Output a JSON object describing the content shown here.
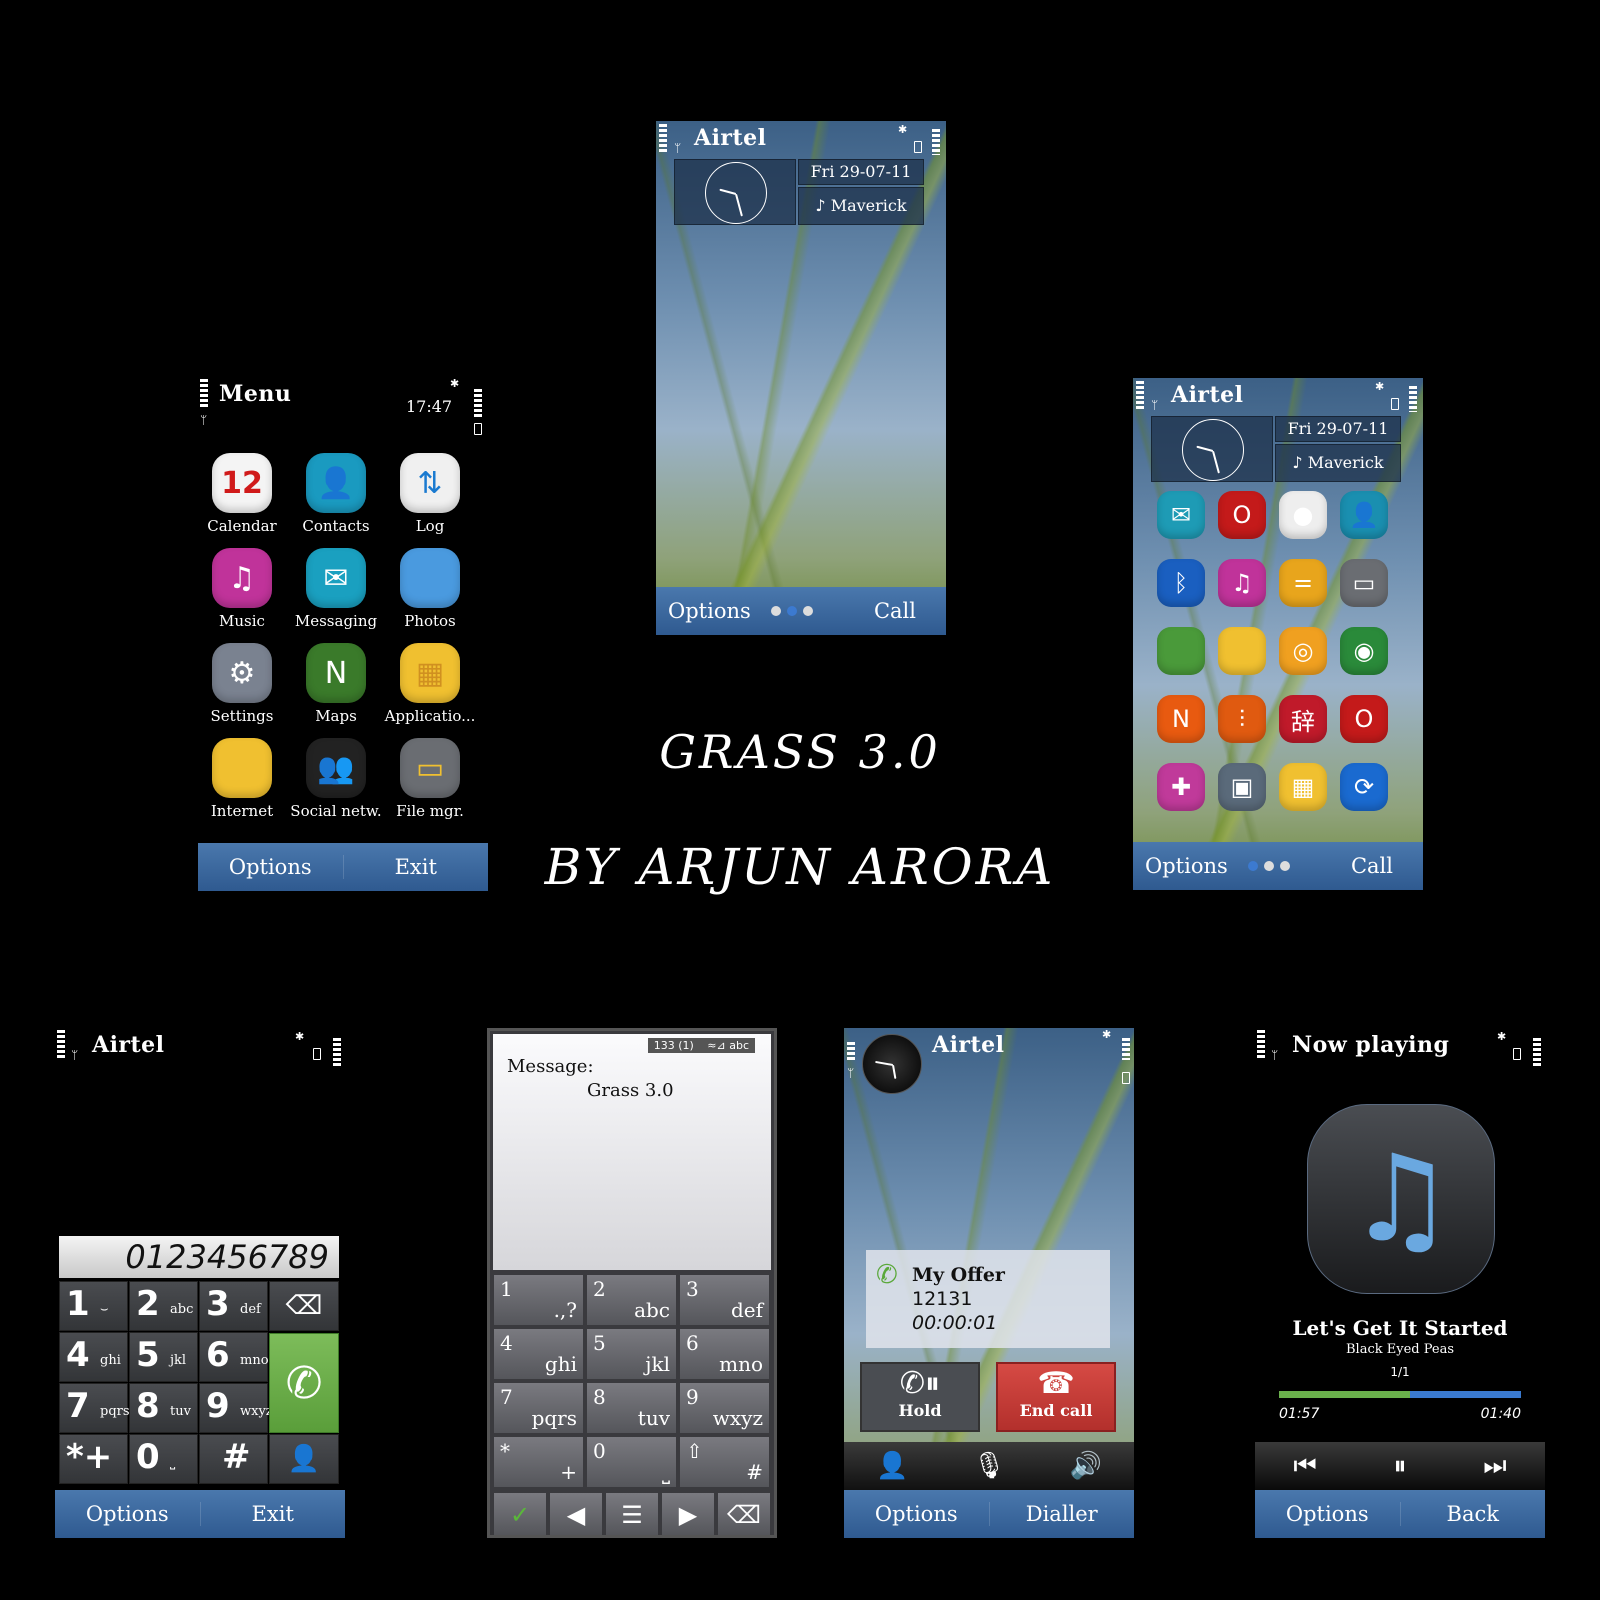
{
  "title": {
    "theme_name": "GRASS 3.0",
    "author_line": "BY ARJUN ARORA"
  },
  "colors": {
    "background": "#000000",
    "softkey_bar": "#3a67a0",
    "call_green": "#6aa84f",
    "end_call_red": "#c93a36",
    "progress_played": "#6ab04c",
    "progress_remaining": "#3a7ad0",
    "music_note": "#6aa8e0"
  },
  "home_screen": {
    "operator": "Airtel",
    "date": "Fri 29-07-11",
    "profile": "♪ Maverick",
    "softkeys": {
      "left": "Options",
      "right": "Call"
    },
    "page_dots": 3,
    "active_dot": 2
  },
  "menu_screen": {
    "title": "Menu",
    "time": "17:47",
    "items": [
      {
        "label": "Calendar",
        "icon": "calendar-icon",
        "glyph": "12"
      },
      {
        "label": "Contacts",
        "icon": "contacts-icon",
        "glyph": "👤"
      },
      {
        "label": "Log",
        "icon": "log-icon",
        "glyph": "⇅"
      },
      {
        "label": "Music",
        "icon": "music-icon",
        "glyph": "♫"
      },
      {
        "label": "Messaging",
        "icon": "messaging-icon",
        "glyph": "✉"
      },
      {
        "label": "Photos",
        "icon": "photos-icon",
        "glyph": ""
      },
      {
        "label": "Settings",
        "icon": "settings-icon",
        "glyph": "⚙"
      },
      {
        "label": "Maps",
        "icon": "maps-icon",
        "glyph": "N"
      },
      {
        "label": "Applicatio...",
        "icon": "applications-icon",
        "glyph": "▦"
      },
      {
        "label": "Internet",
        "icon": "internet-folder-icon",
        "glyph": ""
      },
      {
        "label": "Social netw.",
        "icon": "social-network-icon",
        "glyph": "👥"
      },
      {
        "label": "File mgr.",
        "icon": "file-manager-icon",
        "glyph": "▭"
      }
    ],
    "softkeys": {
      "left": "Options",
      "right": "Exit"
    }
  },
  "home_shortcuts_screen": {
    "operator": "Airtel",
    "date": "Fri 29-07-11",
    "profile": "♪ Maverick",
    "shortcuts": [
      {
        "icon": "messaging-icon",
        "glyph": "✉",
        "color": "#1e9bb5"
      },
      {
        "icon": "opera-icon",
        "glyph": "O",
        "color": "#c41a1a"
      },
      {
        "icon": "palette-icon",
        "glyph": "●",
        "color": "#eeeeee"
      },
      {
        "icon": "contacts-icon",
        "glyph": "👤",
        "color": "#1a8fb0"
      },
      {
        "icon": "bluetooth-icon",
        "glyph": "ᛒ",
        "color": "#1a5fc0"
      },
      {
        "icon": "music-player-icon",
        "glyph": "♫",
        "color": "#c0339a"
      },
      {
        "icon": "notes-icon",
        "glyph": "=",
        "color": "#e8a51c"
      },
      {
        "icon": "file-manager-icon",
        "glyph": "▭",
        "color": "#6a6d72"
      },
      {
        "icon": "photos-icon",
        "glyph": "",
        "color": "#4a9a3a"
      },
      {
        "icon": "folder-icon",
        "glyph": "",
        "color": "#f0c030"
      },
      {
        "icon": "uc-browser-icon",
        "glyph": "◎",
        "color": "#f0a020"
      },
      {
        "icon": "camera-icon",
        "glyph": "◉",
        "color": "#2a8a3a"
      },
      {
        "icon": "nimbuzz-icon",
        "glyph": "N",
        "color": "#e85a10"
      },
      {
        "icon": "rar-icon",
        "glyph": "⫶",
        "color": "#e05a10"
      },
      {
        "icon": "dictionary-icon",
        "glyph": "辞",
        "color": "#c01a2a"
      },
      {
        "icon": "opera-mini-icon",
        "glyph": "O",
        "color": "#c41a1a"
      },
      {
        "icon": "games-icon",
        "glyph": "✚",
        "color": "#c03a9a"
      },
      {
        "icon": "gallery-icon",
        "glyph": "▣",
        "color": "#5a6a7a"
      },
      {
        "icon": "applications-icon",
        "glyph": "▦",
        "color": "#f0c030"
      },
      {
        "icon": "sync-icon",
        "glyph": "⟳",
        "color": "#1a6ad0"
      }
    ],
    "softkeys": {
      "left": "Options",
      "right": "Call"
    },
    "page_dots": 3,
    "active_dot": 1
  },
  "dialer_screen": {
    "operator": "Airtel",
    "number": "0123456789",
    "keys": [
      {
        "digit": "1",
        "letters": "⌣"
      },
      {
        "digit": "2",
        "letters": "abc"
      },
      {
        "digit": "3",
        "letters": "def"
      },
      {
        "digit": "4",
        "letters": "ghi"
      },
      {
        "digit": "5",
        "letters": "jkl"
      },
      {
        "digit": "6",
        "letters": "mno"
      },
      {
        "digit": "7",
        "letters": "pqrs"
      },
      {
        "digit": "8",
        "letters": "tuv"
      },
      {
        "digit": "9",
        "letters": "wxyz"
      },
      {
        "digit": "*+",
        "letters": ""
      },
      {
        "digit": "0",
        "letters": "⎵"
      },
      {
        "digit": "#",
        "letters": ""
      }
    ],
    "softkeys": {
      "left": "Options",
      "right": "Exit"
    }
  },
  "message_screen": {
    "counter": "133 (1)",
    "input_mode": "≈⊿ abc",
    "label": "Message:",
    "body": "Grass 3.0",
    "keys": [
      {
        "digit": "1",
        "letters": ".,?"
      },
      {
        "digit": "2",
        "letters": "abc"
      },
      {
        "digit": "3",
        "letters": "def"
      },
      {
        "digit": "4",
        "letters": "ghi"
      },
      {
        "digit": "5",
        "letters": "jkl"
      },
      {
        "digit": "6",
        "letters": "mno"
      },
      {
        "digit": "7",
        "letters": "pqrs"
      },
      {
        "digit": "8",
        "letters": "tuv"
      },
      {
        "digit": "9",
        "letters": "wxyz"
      },
      {
        "digit": "*",
        "letters": "+"
      },
      {
        "digit": "0",
        "letters": "⎵"
      },
      {
        "digit": "⇧",
        "letters": "#"
      }
    ],
    "toolbar": [
      "✓",
      "◀",
      "☰",
      "▶",
      "⌫"
    ]
  },
  "call_screen": {
    "operator": "Airtel",
    "caller_name": "My Offer",
    "caller_number": "12131",
    "duration": "00:00:01",
    "hold_label": "Hold",
    "end_call_label": "End call",
    "softkeys": {
      "left": "Options",
      "right": "Dialler"
    }
  },
  "music_screen": {
    "title": "Now playing",
    "song": "Let's Get It Started",
    "artist": "Black Eyed Peas",
    "track_position": "1/1",
    "elapsed": "01:57",
    "remaining": "01:40",
    "progress": 0.54,
    "softkeys": {
      "left": "Options",
      "right": "Back"
    }
  }
}
